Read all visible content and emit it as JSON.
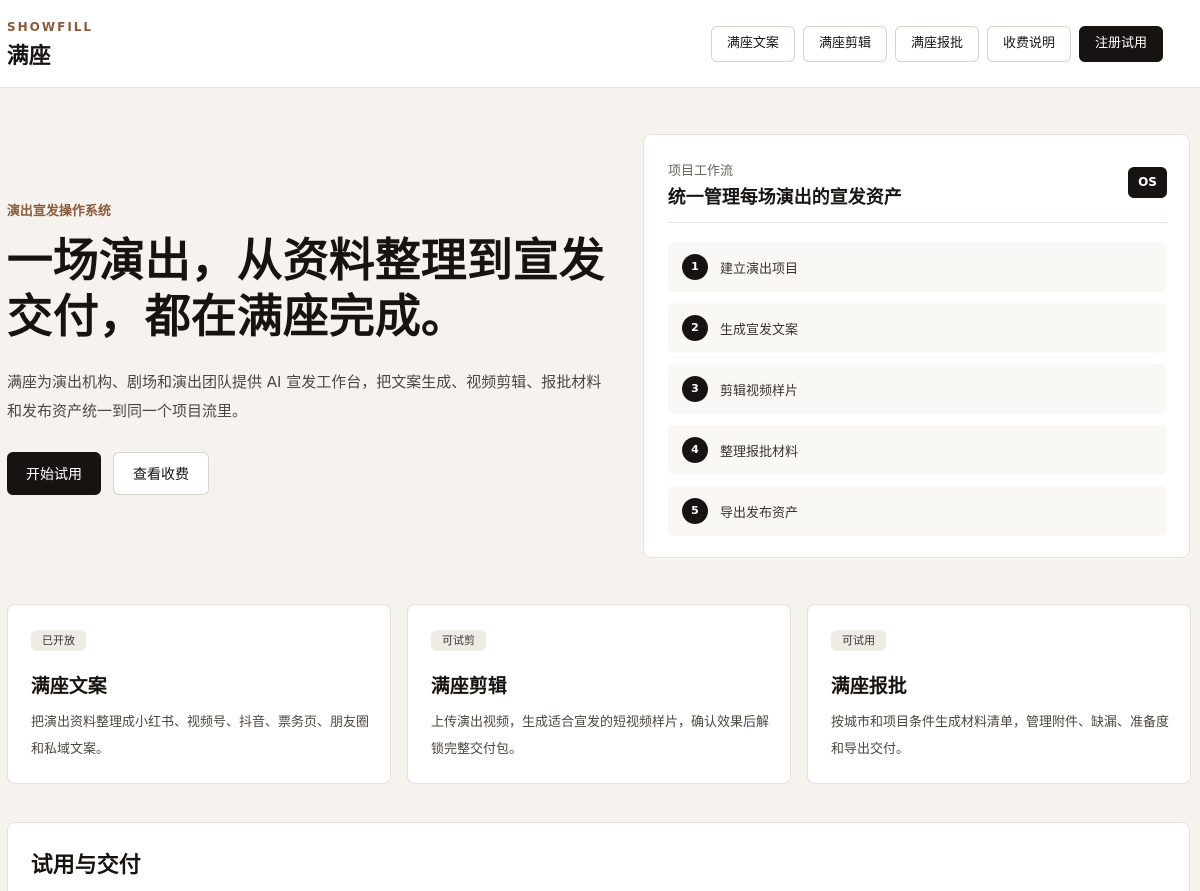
{
  "header": {
    "eyebrow": "SHOWFILL",
    "brand": "满座",
    "nav": [
      {
        "label": "满座文案"
      },
      {
        "label": "满座剪辑"
      },
      {
        "label": "满座报批"
      },
      {
        "label": "收费说明"
      },
      {
        "label": "注册试用"
      }
    ]
  },
  "hero": {
    "eyebrow": "演出宣发操作系统",
    "title_line1": "一场演出，从资料整理到宣发",
    "title_line2": "交付，都在满座完成。",
    "desc_line1": "满座为演出机构、剧场和演出团队提供 AI 宣发工作台，把文案生成、视频剪辑、报批材料",
    "desc_line2": "和发布资产统一到同一个项目流里。",
    "primary_btn": "开始试用",
    "secondary_btn": "查看收费"
  },
  "workflow": {
    "kicker": "项目工作流",
    "title": "统一管理每场演出的宣发资产",
    "badge": "OS",
    "steps": [
      {
        "num": "1",
        "label": "建立演出项目"
      },
      {
        "num": "2",
        "label": "生成宣发文案"
      },
      {
        "num": "3",
        "label": "剪辑视频样片"
      },
      {
        "num": "4",
        "label": "整理报批材料"
      },
      {
        "num": "5",
        "label": "导出发布资产"
      }
    ]
  },
  "cards": [
    {
      "tag": "已开放",
      "title": "满座文案",
      "desc": "把演出资料整理成小红书、视频号、抖音、票务页、朋友圈和私域文案。"
    },
    {
      "tag": "可试剪",
      "title": "满座剪辑",
      "desc": "上传演出视频，生成适合宣发的短视频样片，确认效果后解锁完整交付包。"
    },
    {
      "tag": "可试用",
      "title": "满座报批",
      "desc": "按城市和项目条件生成材料清单，管理附件、缺漏、准备度和导出交付。"
    }
  ],
  "bottom": {
    "title": "试用与交付"
  }
}
